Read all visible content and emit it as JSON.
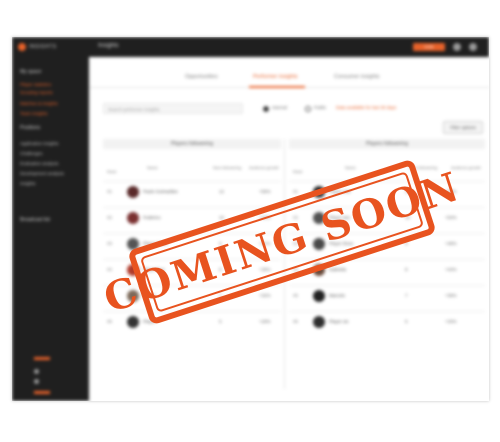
{
  "app": {
    "logo_text": "INSIGHTS",
    "page_title": "Insights",
    "top_button_label": "Invite"
  },
  "sidebar": {
    "groups": [
      {
        "label": "My space"
      },
      {
        "label": "Positions"
      },
      {
        "label": "Broadcast list"
      }
    ],
    "items": [
      {
        "label": "Player statistics",
        "active": true
      },
      {
        "label": "Scouting reports",
        "active": true
      },
      {
        "label": "Matches & insights",
        "active": true
      },
      {
        "label": "Team insights",
        "active": true
      },
      {
        "label": "Application insights",
        "active": false
      },
      {
        "label": "Challenges",
        "active": false
      },
      {
        "label": "Evaluation analysis",
        "active": false
      },
      {
        "label": "Development analysis",
        "active": false
      },
      {
        "label": "Insights",
        "active": false
      }
    ]
  },
  "tabs": [
    {
      "label": "Opportunities",
      "active": false
    },
    {
      "label": "Performer insights",
      "active": true
    },
    {
      "label": "Consumer insights",
      "active": false
    }
  ],
  "search": {
    "placeholder": "Search performer insights"
  },
  "radios": [
    {
      "label": "Internal",
      "on": true
    },
    {
      "label": "Public",
      "on": false
    }
  ],
  "warning_text": "Data available for last 30 days",
  "filter_button": "Filter options",
  "panels": [
    {
      "title": "Players followering",
      "columns": [
        "Rank",
        "Name",
        "New followering",
        "Audience growth"
      ]
    },
    {
      "title": "Players followering",
      "columns": [
        "Rank",
        "Name",
        "New followering",
        "Audience growth"
      ]
    }
  ],
  "rows_left": [
    {
      "rank": "#1",
      "name": "Paulo Guimarães",
      "a": "12",
      "b": "+56%",
      "avatar_color": "#5a2a2a"
    },
    {
      "rank": "#2",
      "name": "Federico",
      "a": "10",
      "b": "+43%",
      "avatar_color": "#7a3030"
    },
    {
      "rank": "#3",
      "name": "Player three",
      "a": "9",
      "b": "+41%",
      "avatar_color": "#555555"
    },
    {
      "rank": "#4",
      "name": "Player four",
      "a": "8",
      "b": "+38%",
      "avatar_color": "#b03a2a"
    },
    {
      "rank": "#5",
      "name": "Player",
      "a": "7",
      "b": "+32%",
      "avatar_color": "#7d6a5a"
    },
    {
      "rank": "#6",
      "name": "Player",
      "a": "5",
      "b": "+29%",
      "avatar_color": "#333333"
    }
  ],
  "rows_right": [
    {
      "rank": "#1",
      "name": "Player one",
      "a": "12",
      "b": "+62%",
      "avatar_color": "#2a2a2a"
    },
    {
      "rank": "#2",
      "name": "Player two",
      "a": "10",
      "b": "+54%",
      "avatar_color": "#444444"
    },
    {
      "rank": "#3",
      "name": "Player three",
      "a": "9",
      "b": "+48%",
      "avatar_color": "#3a3a3a"
    },
    {
      "rank": "#4",
      "name": "Gabriela",
      "a": "8",
      "b": "+44%",
      "avatar_color": "#6a4a3a"
    },
    {
      "rank": "#5",
      "name": "Marcelo",
      "a": "7",
      "b": "+39%",
      "avatar_color": "#222222"
    },
    {
      "rank": "#6",
      "name": "Player six",
      "a": "5",
      "b": "+33%",
      "avatar_color": "#2e2e2e"
    }
  ],
  "stamp_text": "COMING SOON",
  "colors": {
    "accent": "#e8622a",
    "stamp": "#e8531f",
    "dark": "#1f1f1f"
  }
}
